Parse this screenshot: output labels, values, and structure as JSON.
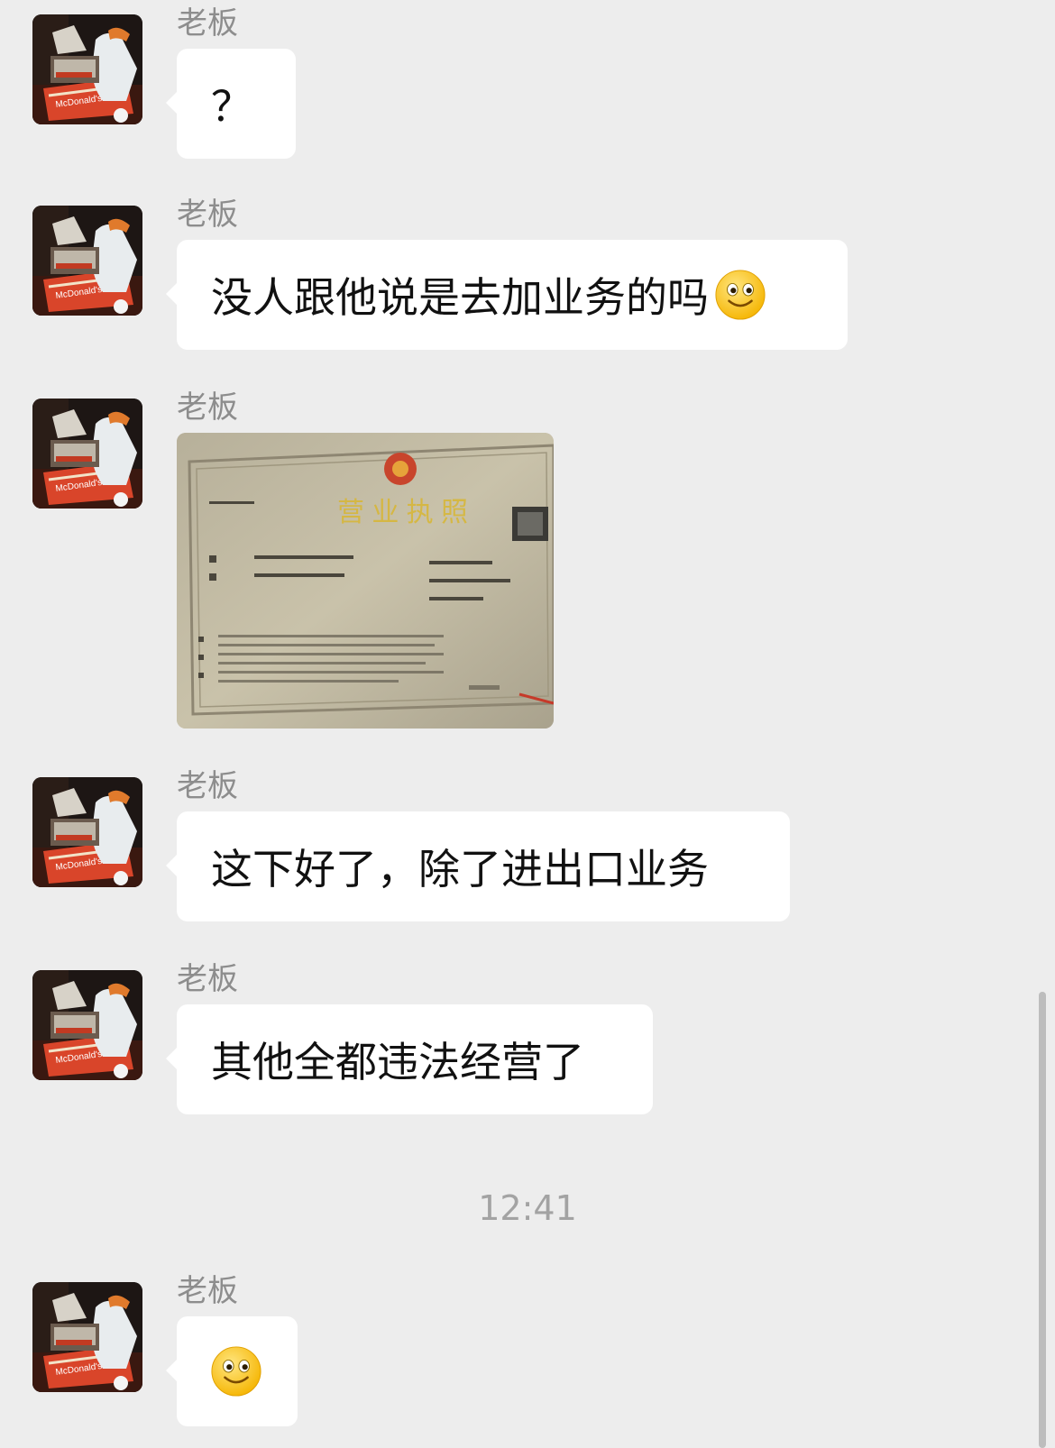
{
  "chat": {
    "messages": [
      {
        "sender": "老板",
        "text": "？"
      },
      {
        "sender": "老板",
        "text": "没人跟他说是去加业务的吗"
      },
      {
        "sender": "老板",
        "image": "business-license-photo"
      },
      {
        "sender": "老板",
        "text": "这下好了，除了进出口业务"
      },
      {
        "sender": "老板",
        "text": "其他全都违法经营了"
      },
      {
        "sender": "老板",
        "emoji": "smile-emoji"
      }
    ],
    "timestamp": "12:41"
  },
  "colors": {
    "background": "#ededed",
    "bubble": "#ffffff",
    "sender_text": "#8d8d8d",
    "timestamp_text": "#a3a3a3"
  }
}
